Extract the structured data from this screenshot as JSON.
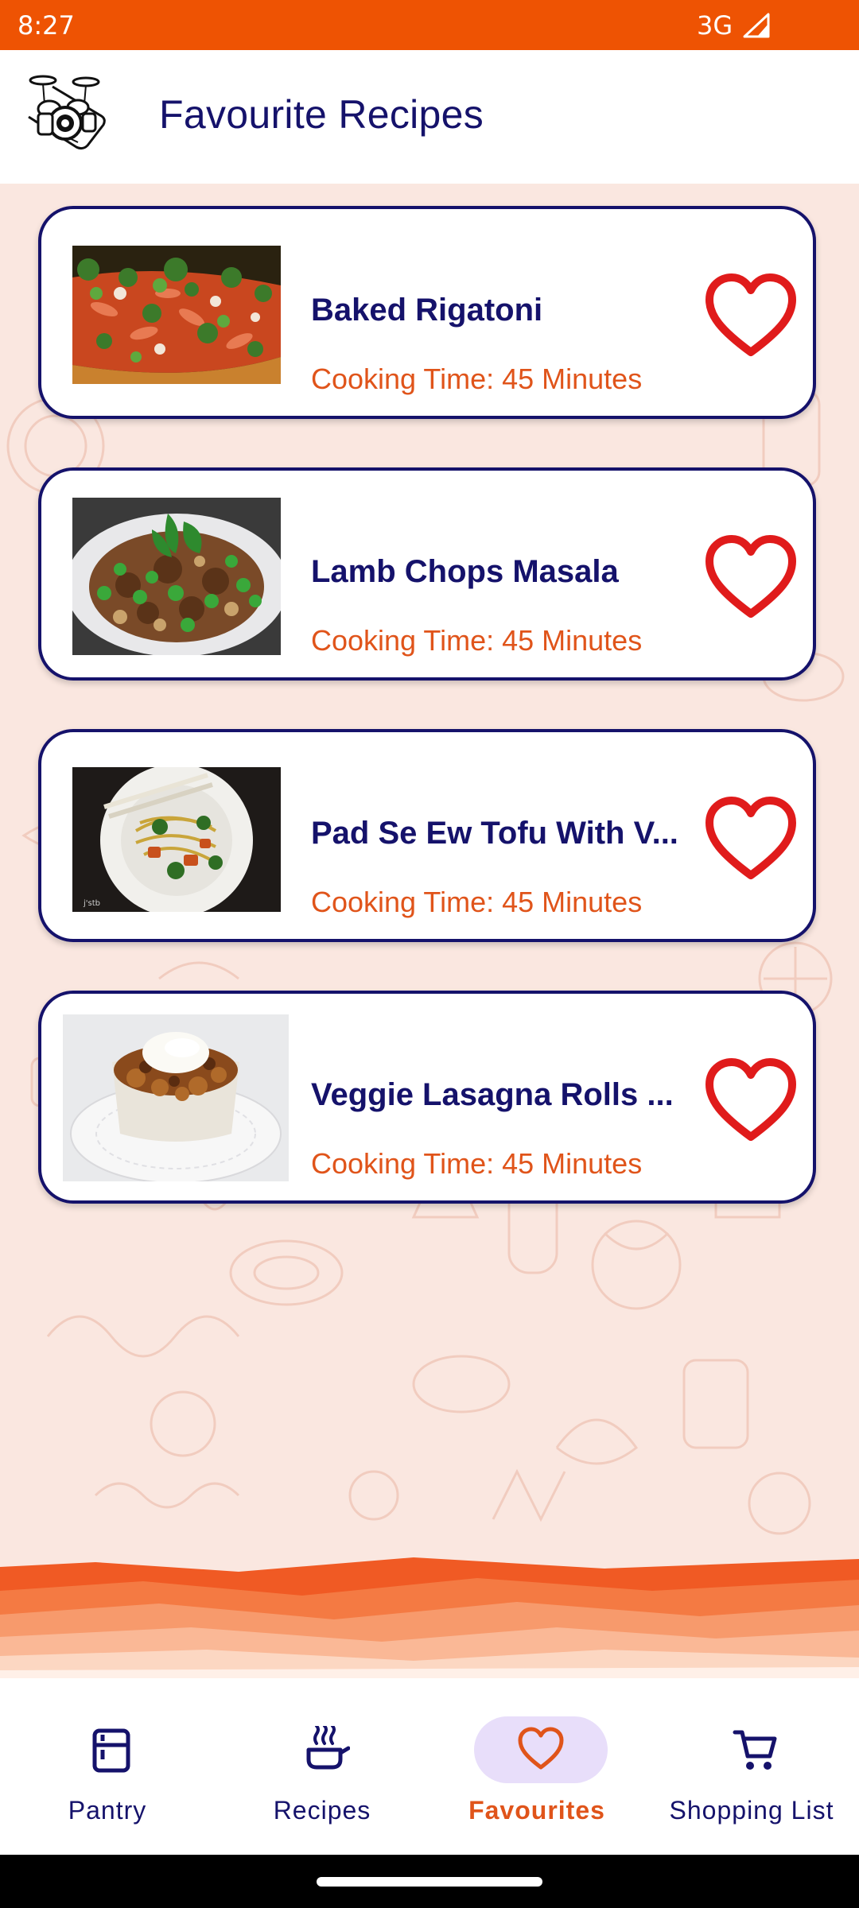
{
  "status_bar": {
    "time": "8:27",
    "network": "3G",
    "background_color": "#ee5303"
  },
  "app_bar": {
    "title": "Favourite Recipes",
    "logo_icon": "drum-kit-phone-logo"
  },
  "recipes": [
    {
      "name": "Baked Rigatoni",
      "cooking_time": "Cooking Time: 45 Minutes",
      "favourite": true
    },
    {
      "name": "Lamb Chops Masala",
      "cooking_time": "Cooking Time: 45 Minutes",
      "favourite": true
    },
    {
      "name": "Pad Se Ew Tofu With V...",
      "cooking_time": "Cooking Time: 45 Minutes",
      "favourite": true
    },
    {
      "name": "Veggie Lasagna Rolls ...",
      "cooking_time": "Cooking Time: 45 Minutes",
      "favourite": true
    }
  ],
  "bottom_nav": {
    "items": [
      {
        "label": "Pantry",
        "icon": "fridge-icon",
        "active": false
      },
      {
        "label": "Recipes",
        "icon": "cooking-pot-icon",
        "active": false
      },
      {
        "label": "Favourites",
        "icon": "heart-icon",
        "active": true
      },
      {
        "label": "Shopping List",
        "icon": "cart-icon",
        "active": false
      }
    ]
  },
  "colors": {
    "primary_navy": "#15126b",
    "accent_orange": "#e0541a",
    "heart_red": "#e01b1b",
    "background_peach": "#fae7e0"
  }
}
